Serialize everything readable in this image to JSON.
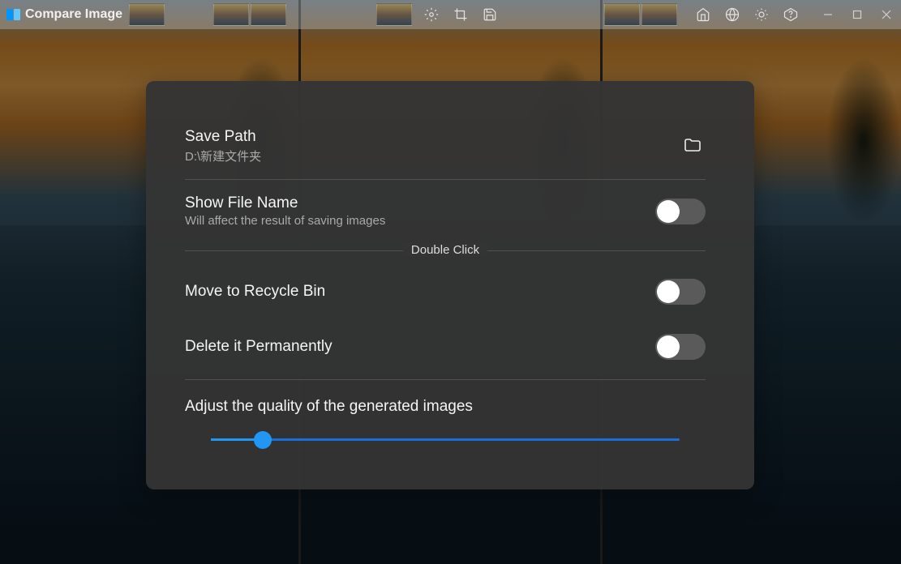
{
  "app": {
    "title": "Compare Image"
  },
  "settings": {
    "save_path": {
      "label": "Save Path",
      "value": "D:\\新建文件夹"
    },
    "show_file_name": {
      "label": "Show File Name",
      "sub": "Will affect the result of saving images",
      "enabled": false
    },
    "double_click_section": "Double Click",
    "move_recycle": {
      "label": "Move to Recycle Bin",
      "enabled": false
    },
    "delete_permanent": {
      "label": "Delete it Permanently",
      "enabled": false
    },
    "quality": {
      "label": "Adjust the quality of the generated images",
      "value": 11
    }
  }
}
